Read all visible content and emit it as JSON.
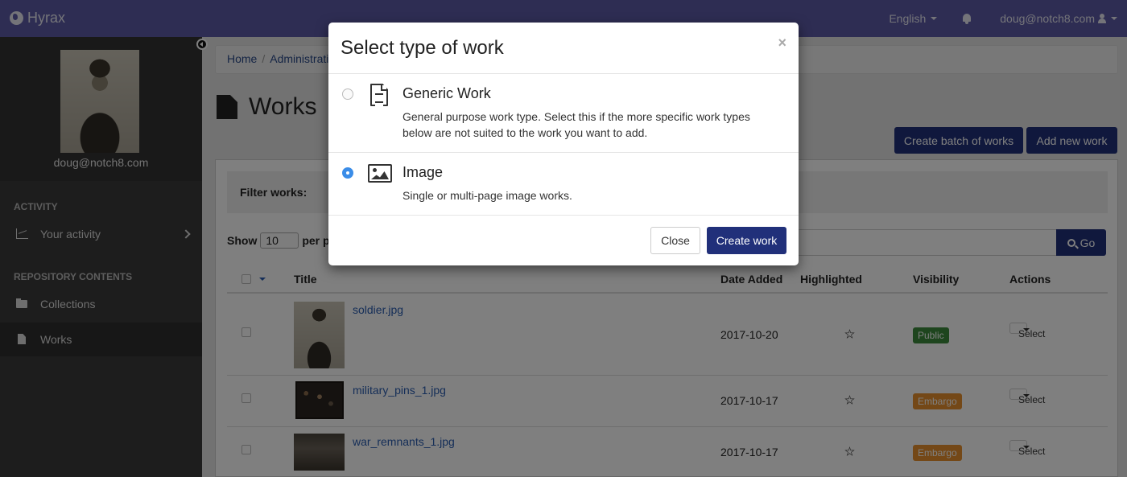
{
  "navbar": {
    "brand": "Hyrax",
    "language": "English",
    "user": "doug@notch8.com"
  },
  "sidebar": {
    "profile_name": "doug@notch8.com",
    "sections": [
      {
        "heading": "ACTIVITY",
        "items": [
          {
            "label": "Your activity",
            "icon": "line-chart-icon"
          }
        ]
      },
      {
        "heading": "REPOSITORY CONTENTS",
        "items": [
          {
            "label": "Collections",
            "icon": "folder-open-icon"
          },
          {
            "label": "Works",
            "icon": "file-icon"
          }
        ]
      }
    ]
  },
  "main": {
    "breadcrumb": [
      "Home",
      "Administrati"
    ],
    "page_title": "Works",
    "create_batch_label": "Create batch of works",
    "add_new_label": "Add new work",
    "filter_label": "Filter works:",
    "show_label": "Show",
    "per_page_value": "10",
    "per_page_label": "per pa",
    "go_label": "Go",
    "columns": [
      "Title",
      "Date Added",
      "Highlighted",
      "Visibility",
      "Actions"
    ],
    "rows": [
      {
        "title": "soldier.jpg",
        "date": "2017-10-20",
        "visibility": "Public",
        "visibility_color": "#3c8a3c",
        "action": "Select"
      },
      {
        "title": "military_pins_1.jpg",
        "date": "2017-10-17",
        "visibility": "Embargo",
        "visibility_color": "#e8912e",
        "action": "Select"
      },
      {
        "title": "war_remnants_1.jpg",
        "date": "2017-10-17",
        "visibility": "Embargo",
        "visibility_color": "#e8912e",
        "action": "Select"
      }
    ]
  },
  "modal": {
    "title": "Select type of work",
    "close_symbol": "×",
    "options": [
      {
        "name": "Generic Work",
        "description": "General purpose work type. Select this if the more specific work types below are not suited to the work you want to add.",
        "icon": "file-text-icon",
        "selected": false
      },
      {
        "name": "Image",
        "description": "Single or multi-page image works.",
        "icon": "picture-icon",
        "selected": true
      }
    ],
    "close_label": "Close",
    "create_label": "Create work"
  },
  "colors": {
    "navbar": "#5c5ba6",
    "primary_button": "#21307a",
    "radio_selected": "#3b8de8",
    "public_badge": "#3c8a3c",
    "embargo_badge": "#e8912e"
  }
}
